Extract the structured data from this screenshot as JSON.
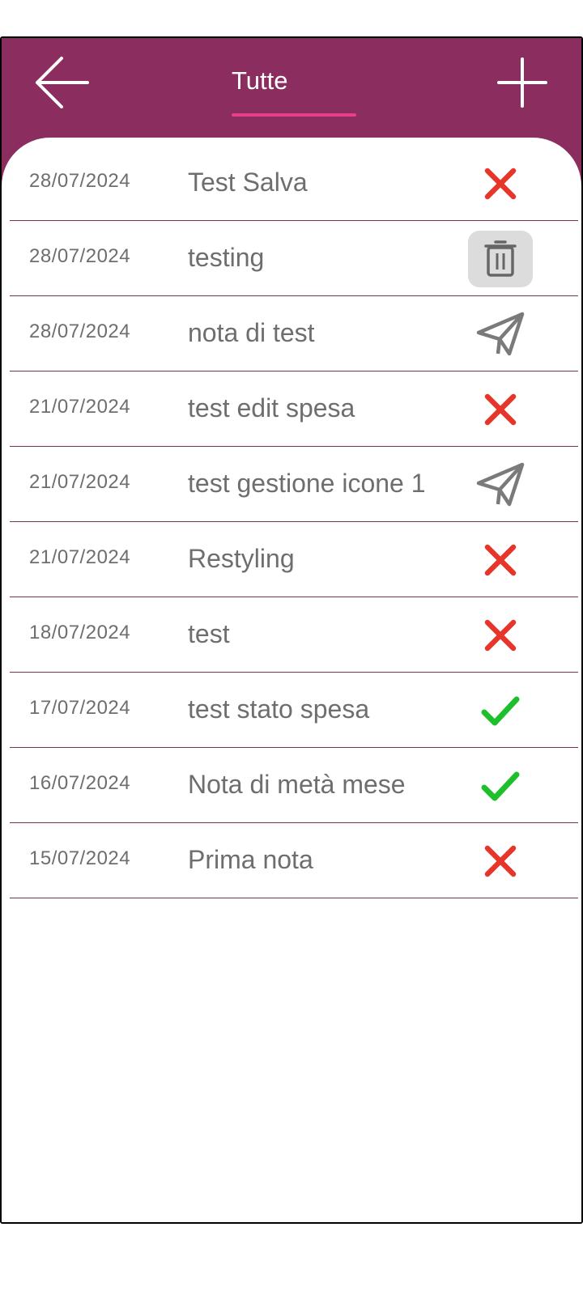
{
  "header": {
    "tab_label": "Tutte",
    "background_color": "#8B2E5F",
    "tab_underline_color": "#E83E8C"
  },
  "notes": [
    {
      "date": "28/07/2024",
      "title": "Test Salva",
      "status_icon": "cross-icon"
    },
    {
      "date": "28/07/2024",
      "title": "testing",
      "status_icon": "trash-icon"
    },
    {
      "date": "28/07/2024",
      "title": "nota di test",
      "status_icon": "paper-plane-icon"
    },
    {
      "date": "21/07/2024",
      "title": "test edit spesa",
      "status_icon": "cross-icon"
    },
    {
      "date": "21/07/2024",
      "title": "test gestione icone 1",
      "status_icon": "paper-plane-icon"
    },
    {
      "date": "21/07/2024",
      "title": "Restyling",
      "status_icon": "cross-icon"
    },
    {
      "date": "18/07/2024",
      "title": "test",
      "status_icon": "cross-icon"
    },
    {
      "date": "17/07/2024",
      "title": "test stato spesa",
      "status_icon": "check-icon"
    },
    {
      "date": "16/07/2024",
      "title": "Nota di metà mese",
      "status_icon": "check-icon"
    },
    {
      "date": "15/07/2024",
      "title": "Prima nota",
      "status_icon": "cross-icon"
    }
  ],
  "colors": {
    "cross": "#E8352A",
    "check": "#1DBF2B",
    "plane": "#7a7a7a",
    "trash_bg": "#dcdcdc",
    "divider": "#7a3152"
  }
}
